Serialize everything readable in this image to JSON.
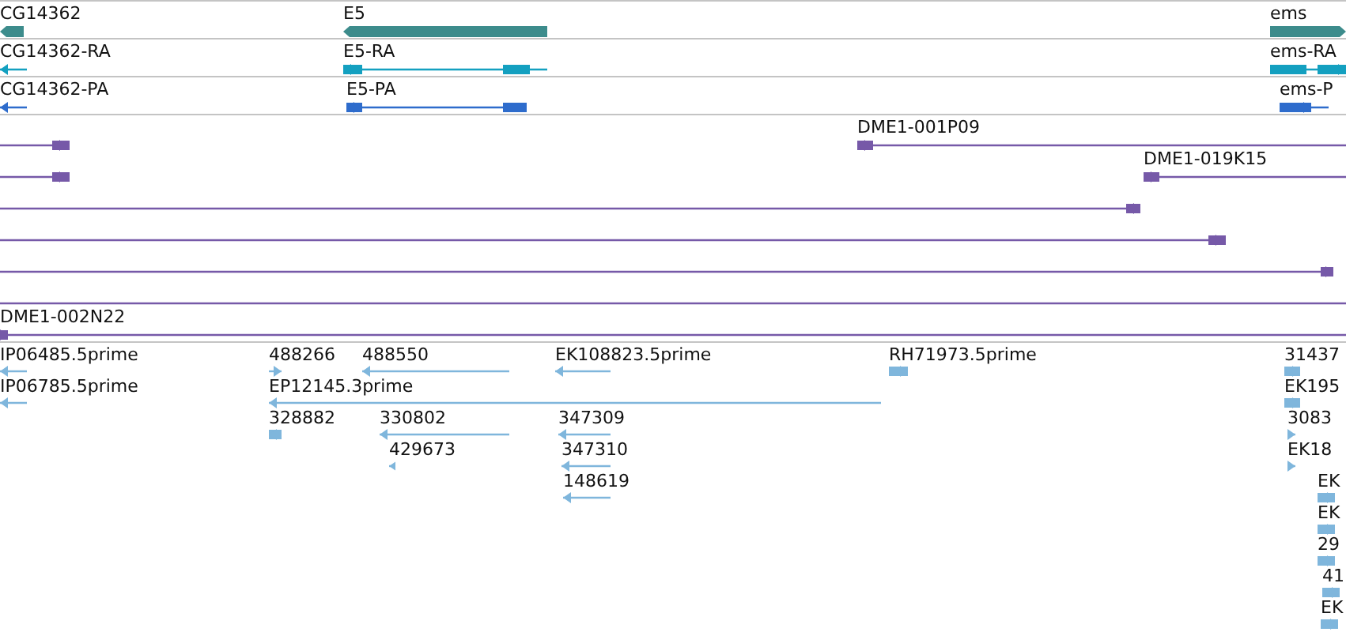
{
  "tracks": [
    {
      "kind": "gene",
      "features": [
        {
          "label": "CG14362",
          "reverse": true
        },
        {
          "label": "E5",
          "reverse": true
        },
        {
          "label": "ems",
          "reverse": false
        }
      ]
    },
    {
      "kind": "transcript",
      "features": [
        {
          "label": "CG14362-RA",
          "reverse": true
        },
        {
          "label": "E5-RA",
          "reverse": true
        },
        {
          "label": "ems-RA",
          "reverse": false
        }
      ]
    },
    {
      "kind": "protein",
      "features": [
        {
          "label": "CG14362-PA",
          "reverse": true
        },
        {
          "label": "E5-PA",
          "reverse": true
        },
        {
          "label": "ems-P",
          "reverse": false
        }
      ]
    },
    {
      "kind": "clone",
      "features": [
        {
          "kind": "arrow",
          "reverse": true
        },
        {
          "kind": "arrow",
          "label": "DME1-001P09",
          "reverse": true
        },
        {
          "kind": "arrow",
          "reverse": true
        },
        {
          "kind": "arrow",
          "label": "DME1-019K15",
          "reverse": true
        },
        {
          "kind": "arrow",
          "reverse": true
        },
        {
          "kind": "arrow",
          "reverse": true
        },
        {
          "kind": "arrow",
          "reverse": false
        },
        {
          "kind": "line"
        },
        {
          "kind": "arrow",
          "label": "DME1-002N22",
          "reverse": false
        }
      ]
    },
    {
      "kind": "est",
      "features": [
        {
          "label": "IP06485.5prime",
          "reverse": true
        },
        {
          "label": "488266",
          "reverse": false
        },
        {
          "label": "488550",
          "reverse": true
        },
        {
          "label": "EK108823.5prime",
          "reverse": true
        },
        {
          "label": "RH71973.5prime",
          "reverse": false
        },
        {
          "label": "31437",
          "reverse": false
        },
        {
          "label": "IP06785.5prime",
          "reverse": true
        },
        {
          "label": "EP12145.3prime",
          "reverse": true
        },
        {
          "label": "EK195",
          "reverse": false
        },
        {
          "label": "328882",
          "reverse": true
        },
        {
          "label": "330802",
          "reverse": true
        },
        {
          "label": "347309",
          "reverse": true
        },
        {
          "label": "3083",
          "reverse": false
        },
        {
          "label": "429673",
          "reverse": true
        },
        {
          "label": "347310",
          "reverse": true
        },
        {
          "label": "EK18",
          "reverse": false
        },
        {
          "label": "148619",
          "reverse": true
        },
        {
          "label": "EK",
          "reverse": false
        },
        {
          "label": "EK",
          "reverse": false
        },
        {
          "label": "29",
          "reverse": false
        },
        {
          "label": "41",
          "reverse": false
        },
        {
          "label": "EK",
          "reverse": false
        }
      ]
    }
  ]
}
